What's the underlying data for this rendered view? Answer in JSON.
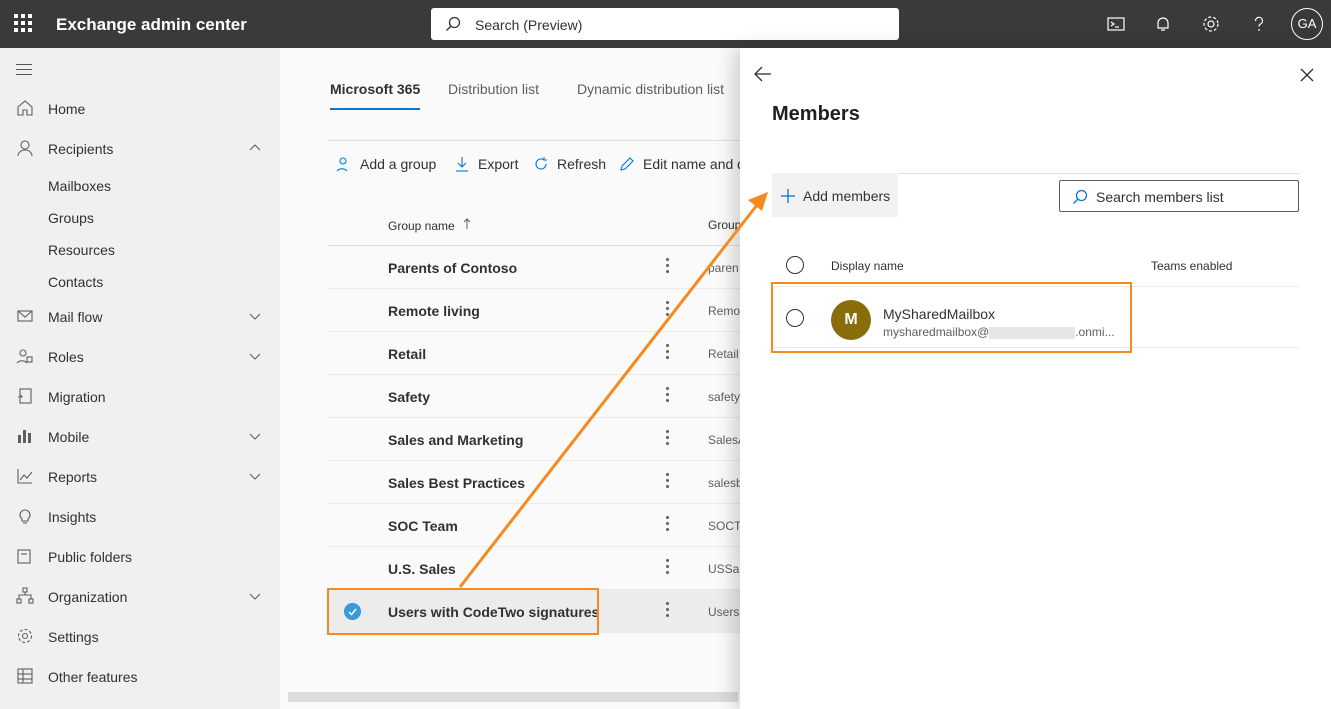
{
  "app": {
    "title": "Exchange admin center",
    "avatar_initials": "GA"
  },
  "search": {
    "placeholder": "Search (Preview)"
  },
  "topbar_icons": [
    "cloud-shell-icon",
    "bell-icon",
    "gear-icon",
    "help-icon"
  ],
  "nav": {
    "items": [
      {
        "label": "Home",
        "icon": "home-icon"
      },
      {
        "label": "Recipients",
        "icon": "person-icon",
        "expanded": true
      },
      {
        "label": "Mail flow",
        "icon": "mail-icon"
      },
      {
        "label": "Roles",
        "icon": "roles-icon"
      },
      {
        "label": "Migration",
        "icon": "migration-icon"
      },
      {
        "label": "Mobile",
        "icon": "mobile-icon"
      },
      {
        "label": "Reports",
        "icon": "reports-icon"
      },
      {
        "label": "Insights",
        "icon": "lightbulb-icon"
      },
      {
        "label": "Public folders",
        "icon": "folder-icon"
      },
      {
        "label": "Organization",
        "icon": "org-icon"
      },
      {
        "label": "Settings",
        "icon": "gear-icon"
      },
      {
        "label": "Other features",
        "icon": "grid-icon"
      }
    ],
    "recipients_sub": [
      "Mailboxes",
      "Groups",
      "Resources",
      "Contacts"
    ]
  },
  "tabs": [
    "Microsoft 365",
    "Distribution list",
    "Dynamic distribution list"
  ],
  "commands": [
    "Add a group",
    "Export",
    "Refresh",
    "Edit name and d"
  ],
  "columns": {
    "group_name": "Group name",
    "group_email": "Group"
  },
  "groups": [
    {
      "name": "Parents of Contoso",
      "alias": "paren"
    },
    {
      "name": "Remote living",
      "alias": "Remo"
    },
    {
      "name": "Retail",
      "alias": "Retail"
    },
    {
      "name": "Safety",
      "alias": "safety"
    },
    {
      "name": "Sales and Marketing",
      "alias": "SalesA"
    },
    {
      "name": "Sales Best Practices",
      "alias": "salesb"
    },
    {
      "name": "SOC Team",
      "alias": "SOCTe"
    },
    {
      "name": "U.S. Sales",
      "alias": "USSal"
    },
    {
      "name": "Users with CodeTwo signatures",
      "alias": "Users"
    }
  ],
  "panel": {
    "title": "Members",
    "add_members": "Add members",
    "search_placeholder": "Search members list",
    "col_display_name": "Display name",
    "col_teams": "Teams enabled",
    "member": {
      "initial": "M",
      "name": "MySharedMailbox",
      "email_prefix": "mysharedmailbox@",
      "email_suffix": ".onmi..."
    }
  },
  "colors": {
    "topbar": "#3b3a39",
    "accent": "#0078d4",
    "highlight": "#f6891f",
    "avatar": "#8a6d0b"
  }
}
